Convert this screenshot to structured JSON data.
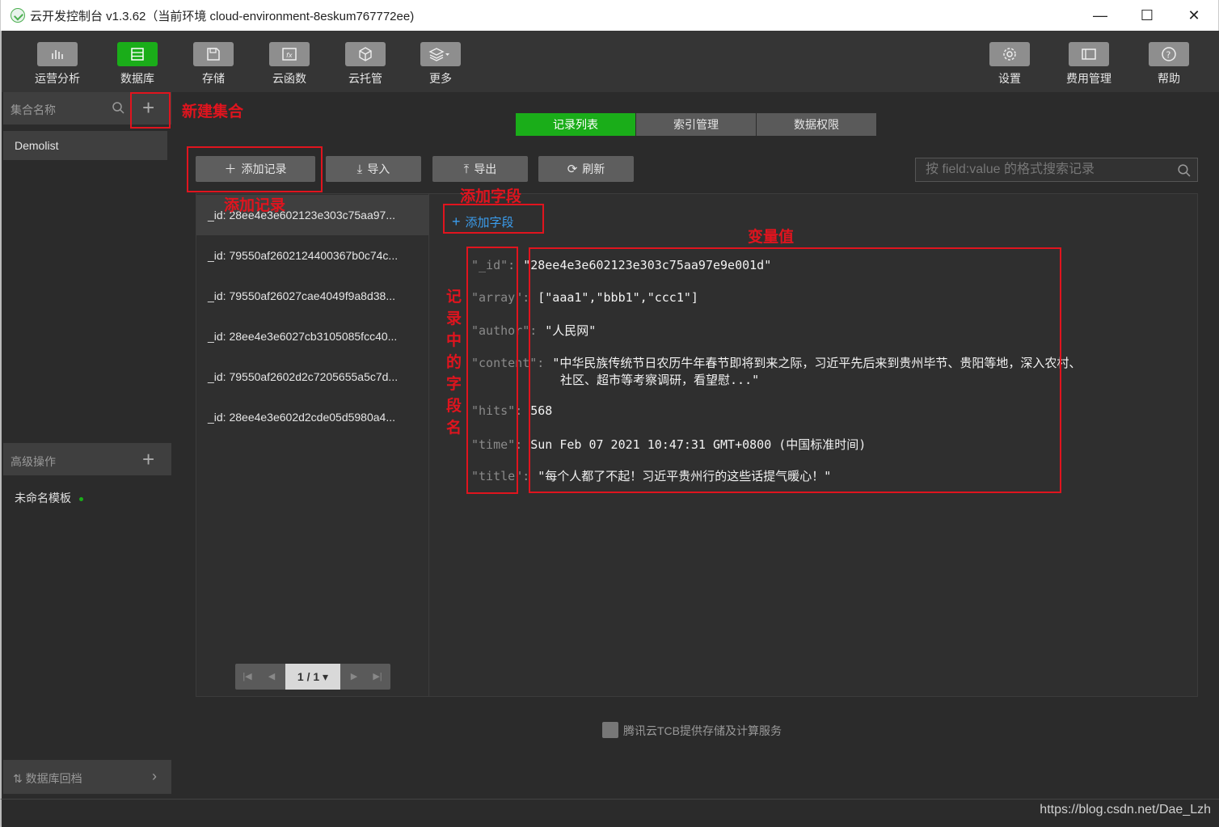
{
  "window": {
    "title": "云开发控制台 v1.3.62（当前环境 cloud-environment-8eskum767772ee)",
    "min": "—",
    "max": "☐",
    "close": "✕"
  },
  "toolbar": {
    "left": [
      {
        "label": "运营分析",
        "icon": "bar-chart-icon"
      },
      {
        "label": "数据库",
        "icon": "database-icon",
        "active": true
      },
      {
        "label": "存储",
        "icon": "save-icon"
      },
      {
        "label": "云函数",
        "icon": "function-icon"
      },
      {
        "label": "云托管",
        "icon": "cube-icon"
      },
      {
        "label": "更多",
        "icon": "layers-icon"
      }
    ],
    "right": [
      {
        "label": "设置",
        "icon": "gear-icon"
      },
      {
        "label": "费用管理",
        "icon": "billing-icon"
      },
      {
        "label": "帮助",
        "icon": "help-icon"
      }
    ]
  },
  "sidebar": {
    "collection_header": "集合名称",
    "collections": [
      "Demolist"
    ],
    "advanced_header": "高级操作",
    "templates": [
      "未命名模板"
    ],
    "backup": "数据库回档"
  },
  "tabs": [
    "记录列表",
    "索引管理",
    "数据权限"
  ],
  "actions": {
    "add_record": "添加记录",
    "import": "导入",
    "export": "导出",
    "refresh": "刷新",
    "search_placeholder": "按 field:value 的格式搜索记录"
  },
  "records": [
    "_id: 28ee4e3e602123e303c75aa97...",
    "_id: 79550af2602124400367b0c74c...",
    "_id: 79550af26027cae4049f9a8d38...",
    "_id: 28ee4e3e6027cb3105085fcc40...",
    "_id: 79550af2602d2c7205655a5c7d...",
    "_id: 28ee4e3e602d2cde05d5980a4..."
  ],
  "pager": {
    "page": "1 / 1"
  },
  "detail": {
    "add_field": "添加字段",
    "fields": [
      {
        "key": "\"_id\"",
        "value": "\"28ee4e3e602123e303c75aa97e9e001d\""
      },
      {
        "key": "\"array\"",
        "value": "[\"aaa1\",\"bbb1\",\"ccc1\"]"
      },
      {
        "key": "\"author\"",
        "value": "\"人民网\""
      },
      {
        "key": "\"content\"",
        "value": "\"中华民族传统节日农历牛年春节即将到来之际，习近平先后来到贵州毕节、贵阳等地，深入农村、",
        "value2": "社区、超市等考察调研，看望慰...\""
      },
      {
        "key": "\"hits\"",
        "value": "568"
      },
      {
        "key": "\"time\"",
        "value": "Sun Feb 07 2021 10:47:31 GMT+0800 (中国标准时间)"
      },
      {
        "key": "\"title\"",
        "value": "\"每个人都了不起！习近平贵州行的这些话提气暖心！\""
      }
    ]
  },
  "footer": "腾讯云TCB提供存储及计算服务",
  "watermark": "https://blog.csdn.net/Dae_Lzh",
  "annotations": {
    "new_collection": "新建集合",
    "add_record": "添加记录",
    "add_field": "添加字段",
    "value": "变量值",
    "field_names": "记录中的字段名"
  },
  "colors": {
    "accent": "#1aad19",
    "annotation": "#e0141e",
    "link": "#3b9ded"
  }
}
